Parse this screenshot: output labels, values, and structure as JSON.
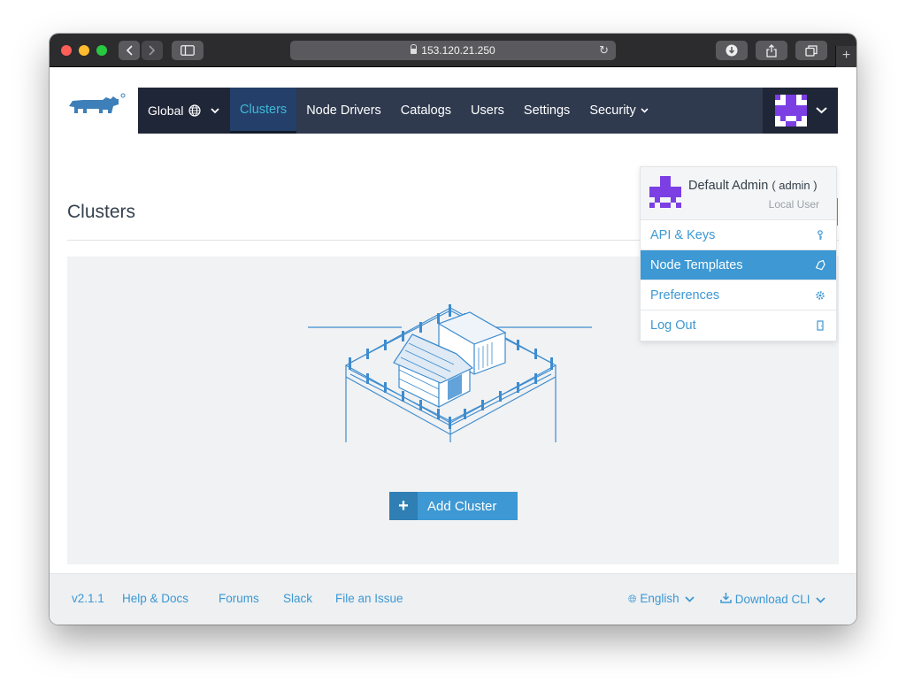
{
  "browser": {
    "url": "153.120.21.250"
  },
  "nav": {
    "global_label": "Global",
    "items": [
      "Clusters",
      "Node Drivers",
      "Catalogs",
      "Users",
      "Settings",
      "Security"
    ]
  },
  "page": {
    "title": "Clusters",
    "add_button_label": "Add Cluster",
    "add_button_icon": "+"
  },
  "user_menu": {
    "name": "Default Admin",
    "username": "( admin )",
    "role": "Local User",
    "items": [
      {
        "label": "API & Keys",
        "icon": "key-icon"
      },
      {
        "label": "Node Templates",
        "icon": "tag-icon",
        "highlighted": true
      },
      {
        "label": "Preferences",
        "icon": "gear-icon"
      },
      {
        "label": "Log Out",
        "icon": "door-icon"
      }
    ]
  },
  "footer": {
    "version": "v2.1.1",
    "help": "Help & Docs",
    "forums": "Forums",
    "slack": "Slack",
    "issue": "File an Issue",
    "language": "English",
    "download": "Download CLI"
  },
  "colors": {
    "nav_bg": "#2f3a4f",
    "accent": "#3d98d3",
    "avatar": "#7b3fe4"
  }
}
